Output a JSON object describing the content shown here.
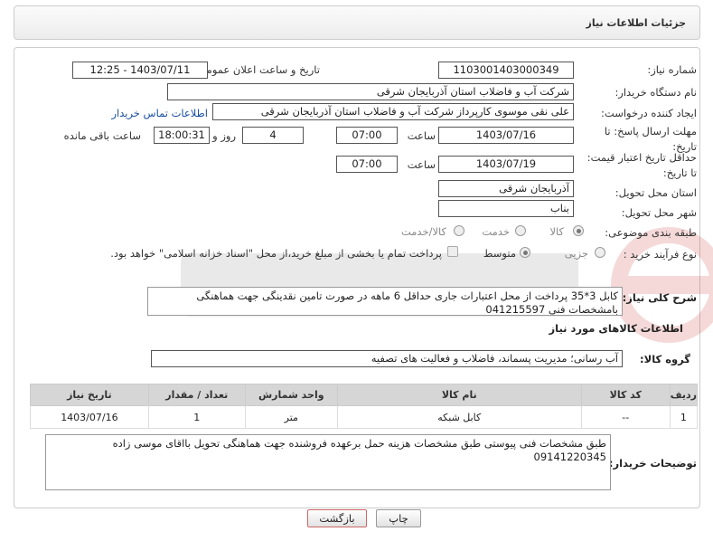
{
  "page_title": "جزئیات اطلاعات نیاز",
  "fields": {
    "need_number_label": "شماره نیاز:",
    "need_number": "1103001403000349",
    "announce_label": "تاریخ و ساعت اعلان عمومی:",
    "announce_value": "1403/07/11 - 12:25",
    "buyer_label": "نام دستگاه خریدار:",
    "buyer_value": "شرکت آب و فاضلاب استان آذربایجان شرقی",
    "creator_label": "ایجاد کننده درخواست:",
    "creator_value": "علی نقی موسوی کارپرداز شرکت آب و فاضلاب استان آذربایجان شرقی",
    "contact_link": "اطلاعات تماس خریدار",
    "deadline_label": "مهلت ارسال پاسخ: تا تاریخ:",
    "deadline_date": "1403/07/16",
    "time_label": "ساعت",
    "deadline_time": "07:00",
    "days_value": "4",
    "days_label": "روز و",
    "remaining_value": "18:00:31",
    "remaining_label": "ساعت باقی مانده",
    "validity_label": "حداقل تاریخ اعتبار قیمت: تا تاریخ:",
    "validity_date": "1403/07/19",
    "validity_time": "07:00",
    "province_label": "استان محل تحویل:",
    "province_value": "آذربایجان شرقی",
    "city_label": "شهر محل تحویل:",
    "city_value": "بناب",
    "category_label": "طبقه بندی موضوعی:",
    "cat_goods": "کالا",
    "cat_service": "خدمت",
    "cat_goods_service": "کالا/خدمت",
    "process_label": "نوع فرآیند خرید :",
    "proc_partial": "جزیی",
    "proc_medium": "متوسط",
    "payment_note": "پرداخت تمام یا بخشی از مبلغ خرید،از محل \"اسناد خزانه اسلامی\" خواهد بود."
  },
  "description": {
    "label": "شرح کلی نیاز:",
    "value": "کابل 3*35 پرداخت از محل اعتبارات جاری حداقل 6 ماهه در صورت تامین نقدینگی جهت هماهنگی بامشخصات فنی 041215597"
  },
  "goods_section": {
    "title": "اطلاعات کالاهای مورد نیاز",
    "group_label": "گروه کالا:",
    "group_value": "آب رسانی؛ مدیریت پسماند، فاضلاب و فعالیت های تصفیه"
  },
  "table": {
    "headers": [
      "ردیف",
      "کد کالا",
      "نام کالا",
      "واحد شمارش",
      "تعداد / مقدار",
      "تاریخ نیاز"
    ],
    "rows": [
      {
        "row": "1",
        "code": "--",
        "name": "کابل شبکه",
        "unit": "متر",
        "qty": "1",
        "date": "1403/07/16"
      }
    ]
  },
  "buyer_notes": {
    "label": "توضیحات خریدار:",
    "value": "طبق مشخصات فنی پیوستی طبق مشخصات هزینه حمل برعهده فروشنده جهت هماهنگی تحویل بااقای موسی زاده 09141220345"
  },
  "buttons": {
    "print": "چاپ",
    "back": "بازگشت"
  },
  "colors": {
    "accent_link": "#1a4fa0",
    "back_button_border": "#c66"
  }
}
